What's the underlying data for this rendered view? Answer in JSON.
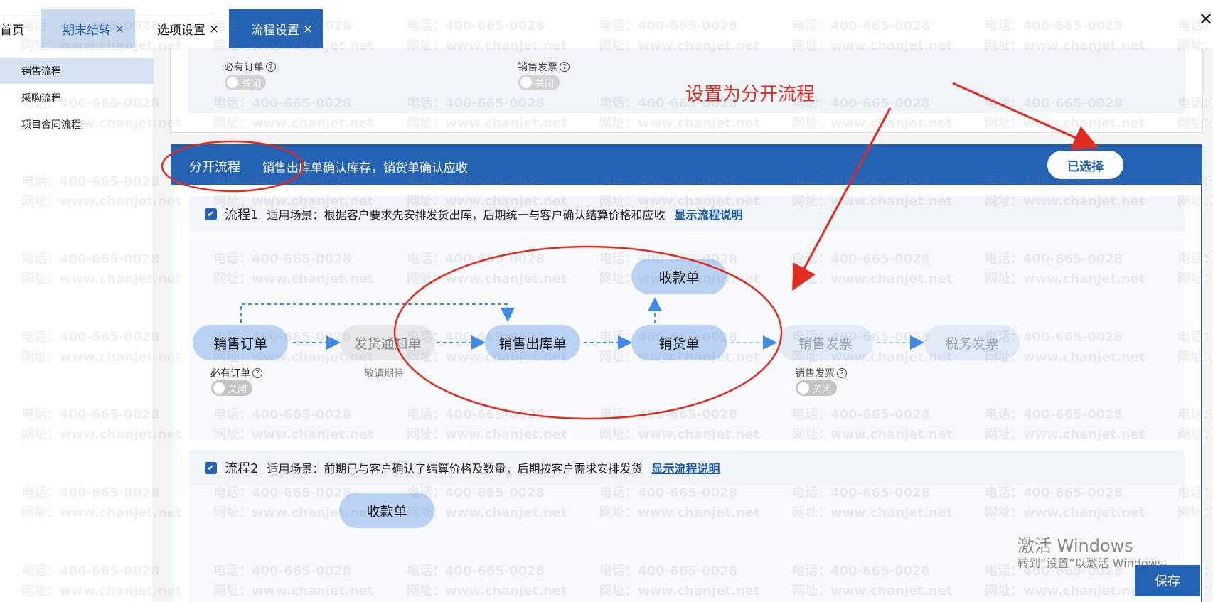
{
  "tabs": {
    "home": "首页",
    "period_close": "期末结转",
    "options": "选项设置",
    "flow_settings": "流程设置",
    "close_glyph": "×"
  },
  "window": {
    "close_glyph": "✕"
  },
  "sidebar": {
    "items": [
      {
        "label": "销售流程"
      },
      {
        "label": "采购流程"
      },
      {
        "label": "项目合同流程"
      }
    ]
  },
  "upper": {
    "order_required": "必有订单",
    "sales_invoice": "销售发票",
    "off_label": "关闭"
  },
  "split_section": {
    "title": "分开流程",
    "desc": "销售出库单确认库存，销货单确认应收",
    "selected_label": "已选择"
  },
  "flow1": {
    "name": "流程1",
    "scene": "适用场景：根据客户要求先安排发货出库，后期统一与客户确认结算价格和应收",
    "link": "显示流程说明",
    "nodes": {
      "sales_order": "销售订单",
      "delivery_notice": "发货通知单",
      "outbound": "销售出库单",
      "sales_doc": "销货单",
      "receipt": "收款单",
      "sales_invoice": "销售发票",
      "tax_invoice": "税务发票"
    },
    "order_required": "必有订单",
    "coming_soon": "敬请期待",
    "invoice_caption": "销售发票",
    "off_label": "关闭"
  },
  "flow2": {
    "name": "流程2",
    "scene": "适用场景：前期已与客户确认了结算价格及数量，后期按客户需求安排发货",
    "link": "显示流程说明",
    "receipt": "收款单"
  },
  "annotation": {
    "text": "设置为分开流程",
    "color": "#e02b20"
  },
  "watermark": {
    "phone": "电话：400-665-0028",
    "site": "网址：www.chanjet.net"
  },
  "activation": {
    "line1": "激活 Windows",
    "line2": "转到“设置”以激活 Windows。"
  },
  "save_label": "保存",
  "colors": {
    "primary": "#2462b4",
    "node": "#bad3f5",
    "annotation": "#e02b20"
  }
}
